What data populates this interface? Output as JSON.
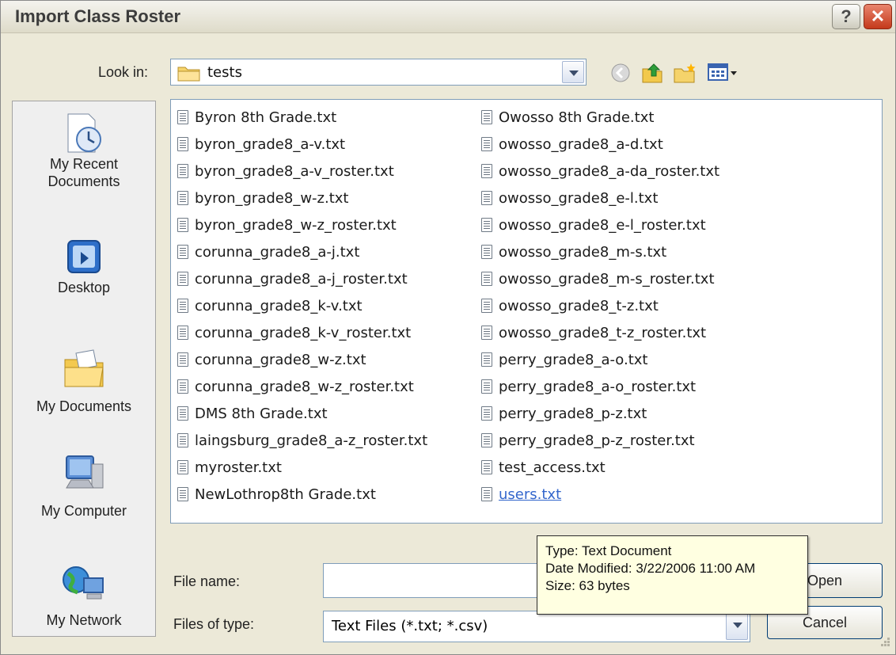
{
  "window": {
    "title": "Import Class Roster",
    "help_label": "?",
    "close_label": "✕"
  },
  "look_in": {
    "label": "Look in:",
    "value": "tests"
  },
  "places": [
    {
      "label": "My Recent\nDocuments",
      "icon": "recent-documents-icon"
    },
    {
      "label": "Desktop",
      "icon": "desktop-icon"
    },
    {
      "label": "My Documents",
      "icon": "my-documents-icon"
    },
    {
      "label": "My Computer",
      "icon": "my-computer-icon"
    },
    {
      "label": "My Network",
      "icon": "my-network-icon"
    }
  ],
  "files_col1": [
    "Byron 8th Grade.txt",
    "byron_grade8_a-v.txt",
    "byron_grade8_a-v_roster.txt",
    "byron_grade8_w-z.txt",
    "byron_grade8_w-z_roster.txt",
    "corunna_grade8_a-j.txt",
    "corunna_grade8_a-j_roster.txt",
    "corunna_grade8_k-v.txt",
    "corunna_grade8_k-v_roster.txt",
    "corunna_grade8_w-z.txt",
    "corunna_grade8_w-z_roster.txt",
    "DMS 8th Grade.txt",
    "laingsburg_grade8_a-z_roster.txt",
    "myroster.txt",
    "NewLothrop8th Grade.txt"
  ],
  "files_col2": [
    "Owosso 8th Grade.txt",
    "owosso_grade8_a-d.txt",
    "owosso_grade8_a-da_roster.txt",
    "owosso_grade8_e-l.txt",
    "owosso_grade8_e-l_roster.txt",
    "owosso_grade8_m-s.txt",
    "owosso_grade8_m-s_roster.txt",
    "owosso_grade8_t-z.txt",
    "owosso_grade8_t-z_roster.txt",
    "perry_grade8_a-o.txt",
    "perry_grade8_a-o_roster.txt",
    "perry_grade8_p-z.txt",
    "perry_grade8_p-z_roster.txt",
    "test_access.txt",
    "users.txt"
  ],
  "file_name": {
    "label": "File name:",
    "value": ""
  },
  "file_type": {
    "label": "Files of type:",
    "value": "Text Files (*.txt; *.csv)"
  },
  "buttons": {
    "open": "Open",
    "open_visible": "en",
    "cancel": "Cancel"
  },
  "tooltip": {
    "type": "Type: Text Document",
    "modified": "Date Modified: 3/22/2006 11:00 AM",
    "size": "Size: 63 bytes"
  },
  "colors": {
    "link": "#3366cc",
    "tooltip_bg": "#ffffe1",
    "dialog_bg": "#ece9d8"
  }
}
